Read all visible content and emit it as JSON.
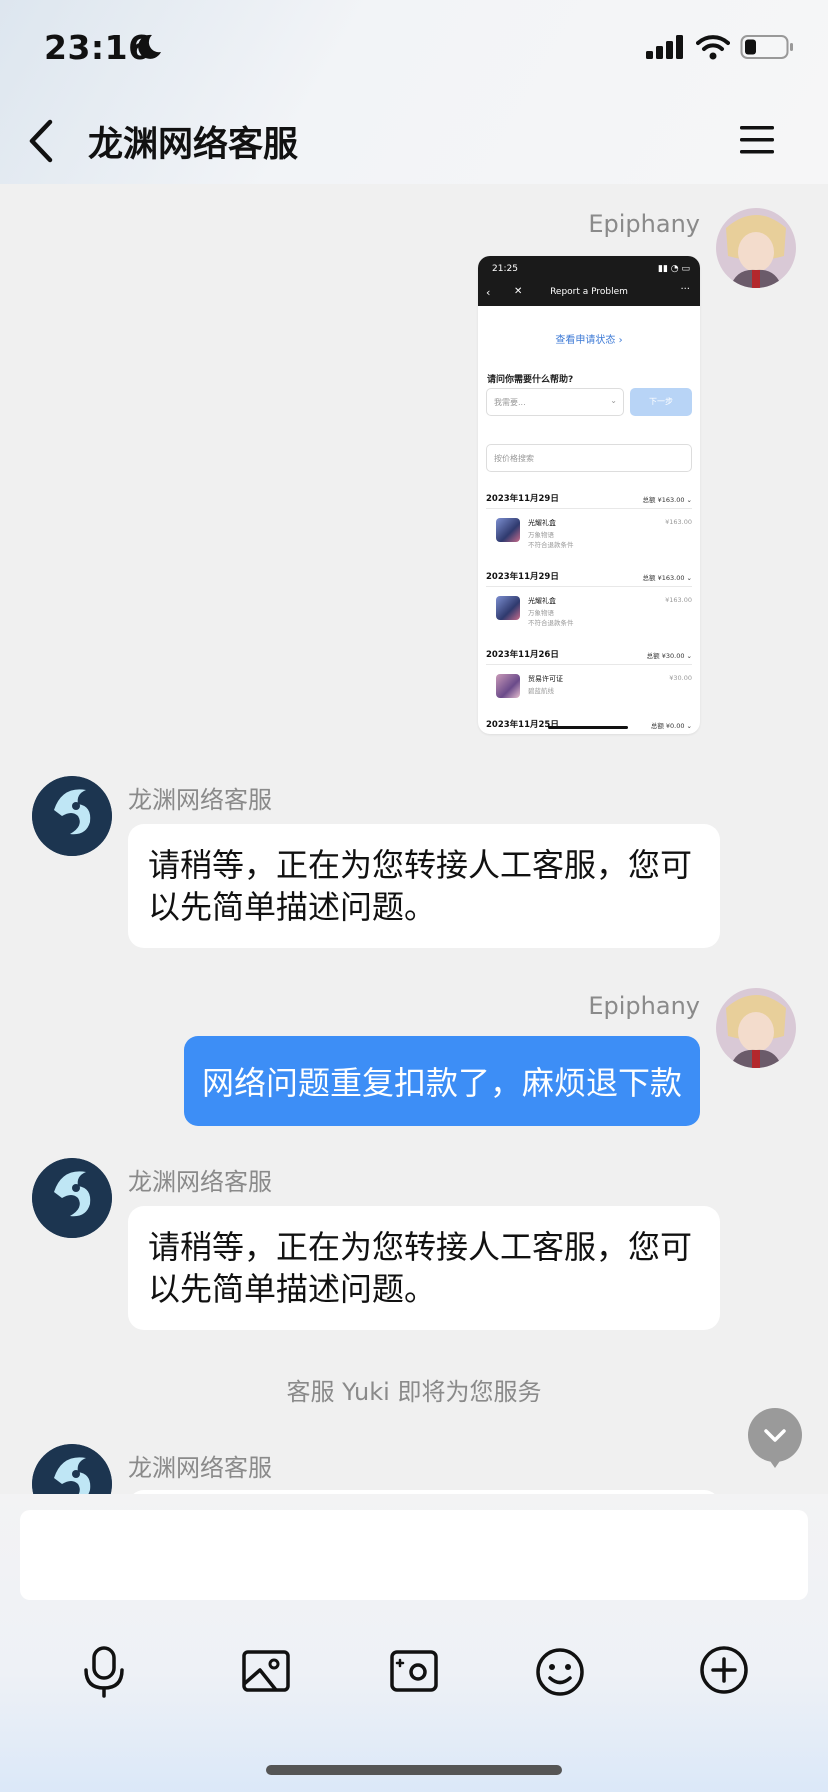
{
  "status_bar": {
    "time": "23:16",
    "icons": [
      "moon-icon",
      "signal-icon",
      "wifi-icon",
      "battery-icon"
    ]
  },
  "header": {
    "title": "龙渊网络客服",
    "back_icon": "chevron-left-icon",
    "menu_icon": "hamburger-menu-icon"
  },
  "messages": [
    {
      "side": "right",
      "sender": "Epiphany",
      "type": "image"
    },
    {
      "side": "left",
      "sender": "龙渊网络客服",
      "type": "text",
      "text": "请稍等，正在为您转接人工客服，您可以先简单描述问题。"
    },
    {
      "side": "right",
      "sender": "Epiphany",
      "type": "text",
      "text": "网络问题重复扣款了，麻烦退下款"
    },
    {
      "side": "left",
      "sender": "龙渊网络客服",
      "type": "text",
      "text": "请稍等，正在为您转接人工客服，您可以先简单描述问题。"
    },
    {
      "type": "system",
      "text": "客服 Yuki 即将为您服务"
    },
    {
      "side": "left",
      "sender": "龙渊网络客服",
      "type": "text",
      "text": ""
    }
  ],
  "shot": {
    "time": "21:25",
    "title": "Report a Problem",
    "status_link": "查看申请状态 ›",
    "question": "请问你需要什么帮助?",
    "select_placeholder": "我需要...",
    "next_button": "下一步",
    "search_placeholder": "按价格搜索",
    "orders": [
      {
        "date": "2023年11月29日",
        "total": "总额 ¥163.00 ⌄",
        "name": "光耀礼盒",
        "sub1": "万象物语",
        "sub2": "不符合退款条件",
        "price": "¥163.00"
      },
      {
        "date": "2023年11月29日",
        "total": "总额 ¥163.00 ⌄",
        "name": "光耀礼盒",
        "sub1": "万象物语",
        "sub2": "不符合退款条件",
        "price": "¥163.00"
      },
      {
        "date": "2023年11月26日",
        "total": "总额 ¥30.00 ⌄",
        "name": "贸易许可证",
        "sub1": "碧蓝航线",
        "sub2": "",
        "price": "¥30.00"
      },
      {
        "date": "2023年11月25日",
        "total": "总额 ¥0.00 ⌄"
      }
    ]
  },
  "input": {
    "placeholder": ""
  },
  "toolbar": [
    "microphone-icon",
    "image-icon",
    "photo-camera-icon",
    "emoji-icon",
    "plus-circle-icon"
  ],
  "colors": {
    "accent": "#3d8ef6",
    "bubble": "#ffffff",
    "background": "#f0f0f0"
  }
}
